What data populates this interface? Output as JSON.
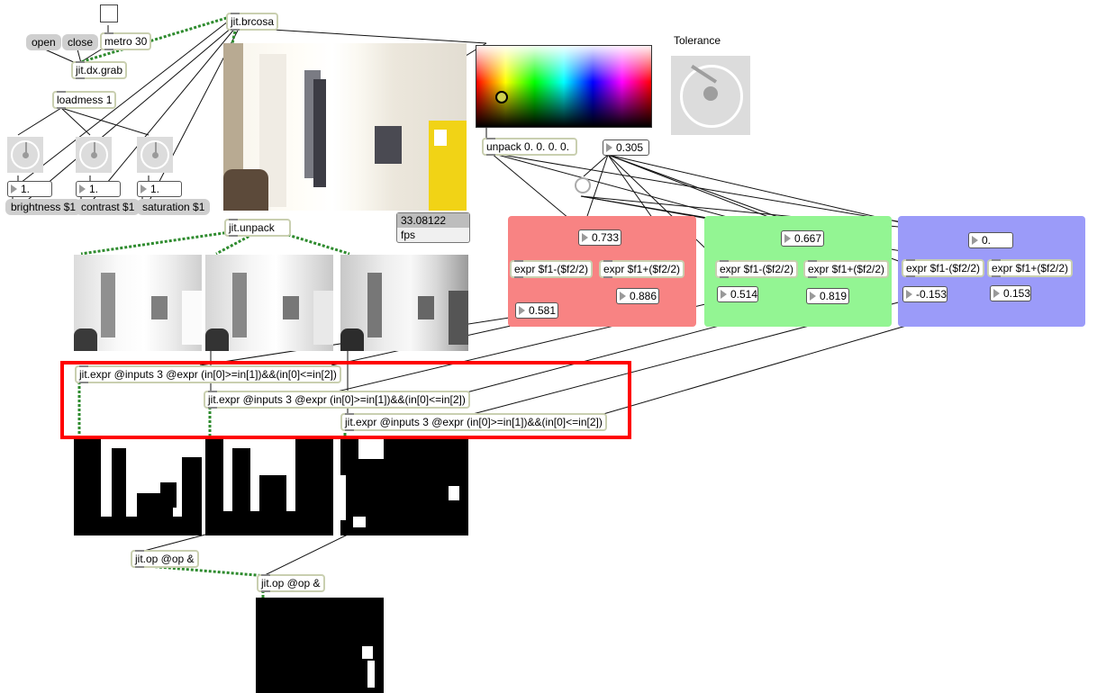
{
  "messages": {
    "open": "open",
    "close": "close"
  },
  "objects": {
    "metro": "metro 30",
    "grab": "jit.dx.grab",
    "loadmess": "loadmess 1",
    "brcosa": "jit.brcosa",
    "brightness": "brightness $1",
    "contrast": "contrast $1",
    "saturation": "saturation $1",
    "unpack_jit": "jit.unpack",
    "unpack_color": "unpack 0. 0. 0. 0.",
    "expr_minus": "expr $f1-($f2/2)",
    "expr_plus": "expr $f1+($f2/2)",
    "jit_expr": "jit.expr @inputs 3 @expr (in[0]>=in[1])&&(in[0]<=in[2])",
    "jit_op": "jit.op @op &"
  },
  "numbers": {
    "brightness": "1.",
    "contrast": "1.",
    "saturation": "1.",
    "tolerance": "0.305",
    "fps_value": "33.08122",
    "fps_label": "fps",
    "red_center": "0.733",
    "red_low": "0.581",
    "red_high": "0.886",
    "green_center": "0.667",
    "green_low": "0.514",
    "green_high": "0.819",
    "blue_center": "0.",
    "blue_low": "-0.153",
    "blue_high": "0.153"
  },
  "tolerance_label": "Tolerance",
  "colors": {
    "red_panel": "#f88383",
    "green_panel": "#93f593",
    "blue_panel": "#9b9bf9",
    "highlight": "#ff0000",
    "patchcord": "#2e8b2e",
    "object_border": "#c9cfb0"
  }
}
